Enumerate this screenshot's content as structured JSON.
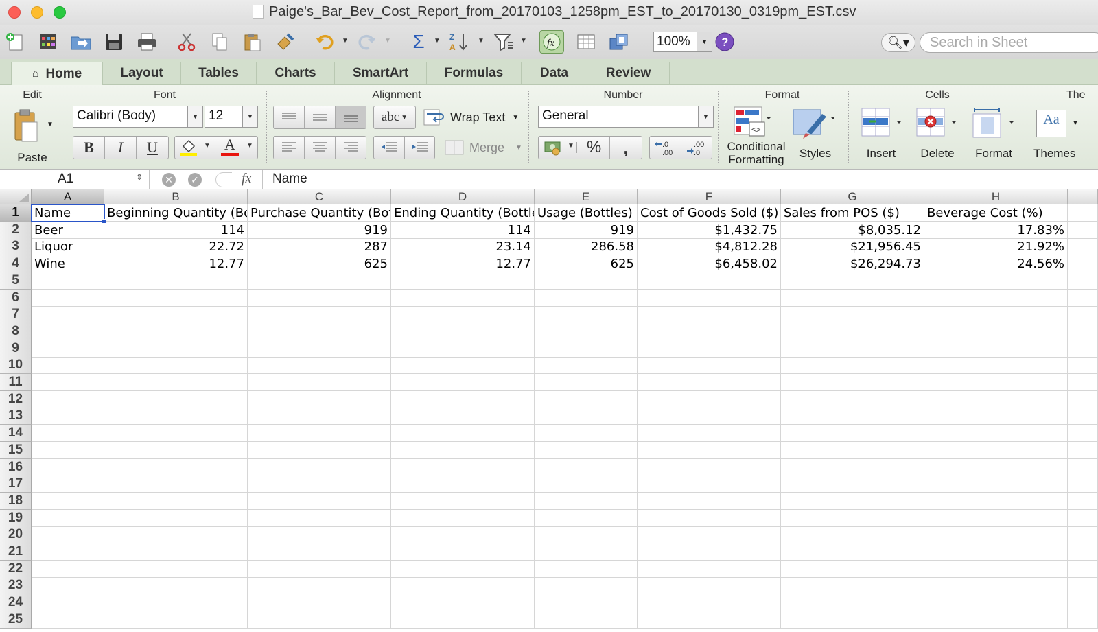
{
  "window": {
    "title": "Paige's_Bar_Bev_Cost_Report_from_20170103_1258pm_EST_to_20170130_0319pm_EST.csv"
  },
  "toolbar": {
    "icons": [
      "new-icon",
      "gallery-icon",
      "open-icon",
      "save-icon",
      "print-icon",
      "cut-icon",
      "copy-icon",
      "paste-icon",
      "format-painter-icon",
      "undo-icon",
      "redo-icon",
      "autosum-icon",
      "sort-icon",
      "filter-icon",
      "formula-builder-icon",
      "show-gallery-icon",
      "toolbox-icon",
      "help-icon"
    ],
    "zoom": "100%",
    "search_placeholder": "Search in Sheet"
  },
  "tabs": [
    {
      "label": "Home",
      "active": true
    },
    {
      "label": "Layout"
    },
    {
      "label": "Tables"
    },
    {
      "label": "Charts"
    },
    {
      "label": "SmartArt"
    },
    {
      "label": "Formulas"
    },
    {
      "label": "Data"
    },
    {
      "label": "Review"
    }
  ],
  "ribbon": {
    "groups": {
      "edit": "Edit",
      "font": "Font",
      "alignment": "Alignment",
      "number": "Number",
      "format": "Format",
      "cells": "Cells",
      "themes": "The"
    },
    "paste_label": "Paste",
    "font_name": "Calibri (Body)",
    "font_size": "12",
    "bold": "B",
    "italic": "I",
    "underline": "U",
    "font_color_letter": "A",
    "wrap_abc": "abc",
    "wrap_text": "Wrap Text",
    "merge": "Merge",
    "number_format": "General",
    "percent": "%",
    "comma": ",",
    "conditional_formatting": [
      "Conditional",
      "Formatting"
    ],
    "styles": "Styles",
    "insert": "Insert",
    "delete": "Delete",
    "format": "Format",
    "themes": "Themes",
    "themes_icon": "Aa"
  },
  "formula_bar": {
    "cell_ref": "A1",
    "fx": "fx",
    "content": "Name"
  },
  "sheet": {
    "columns": [
      "A",
      "B",
      "C",
      "D",
      "E",
      "F",
      "G",
      "H"
    ],
    "row_numbers": [
      "1",
      "2",
      "3",
      "4",
      "5",
      "6",
      "7",
      "8",
      "9",
      "10",
      "11",
      "12",
      "13",
      "14",
      "15",
      "16",
      "17",
      "18",
      "19",
      "20",
      "21",
      "22",
      "23",
      "24",
      "25"
    ],
    "headers": [
      "Name",
      "Beginning Quantity (Bottl",
      "Purchase Quantity (Bottle",
      "Ending Quantity (Bottles)",
      "Usage (Bottles)",
      "Cost of Goods Sold ($)",
      "Sales from POS ($)",
      "Beverage Cost (%)"
    ],
    "rows": [
      [
        "Beer",
        "114",
        "919",
        "114",
        "919",
        "$1,432.75",
        "$8,035.12",
        "17.83%"
      ],
      [
        "Liquor",
        "22.72",
        "287",
        "23.14",
        "286.58",
        "$4,812.28",
        "$21,956.45",
        "21.92%"
      ],
      [
        "Wine",
        "12.77",
        "625",
        "12.77",
        "625",
        "$6,458.02",
        "$26,294.73",
        "24.56%"
      ]
    ]
  },
  "colors": {
    "accent_selection": "#2a55c8",
    "tab_bar": "#d3dfcd",
    "font_color_red": "#e8140f",
    "highlight_yellow": "#ffee00"
  }
}
